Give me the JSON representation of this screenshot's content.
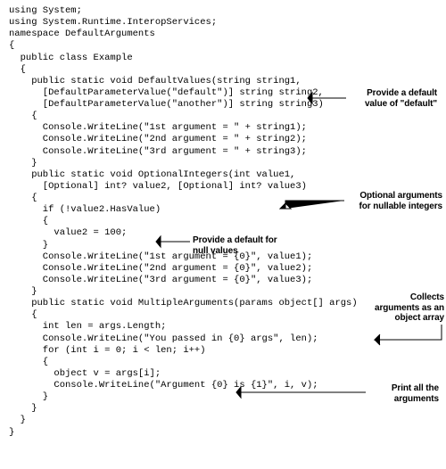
{
  "code": {
    "l1": "using System;",
    "l2": "using System.Runtime.InteropServices;",
    "l3": "",
    "l4": "namespace DefaultArguments",
    "l5": "{",
    "l6": "  public class Example",
    "l7": "  {",
    "l8": "    public static void DefaultValues(string string1,",
    "l9": "      [DefaultParameterValue(\"default\")] string string2,",
    "l10": "      [DefaultParameterValue(\"another\")] string string3)",
    "l11": "    {",
    "l12": "      Console.WriteLine(\"1st argument = \" + string1);",
    "l13": "      Console.WriteLine(\"2nd argument = \" + string2);",
    "l14": "      Console.WriteLine(\"3rd argument = \" + string3);",
    "l15": "    }",
    "l16": "",
    "l17": "    public static void OptionalIntegers(int value1,",
    "l18": "      [Optional] int? value2, [Optional] int? value3)",
    "l19": "    {",
    "l20": "      if (!value2.HasValue)",
    "l21": "      {",
    "l22": "        value2 = 100;",
    "l23": "      }",
    "l24": "      Console.WriteLine(\"1st argument = {0}\", value1);",
    "l25": "      Console.WriteLine(\"2nd argument = {0}\", value2);",
    "l26": "      Console.WriteLine(\"3rd argument = {0}\", value3);",
    "l27": "    }",
    "l28": "",
    "l29": "    public static void MultipleArguments(params object[] args)",
    "l30": "    {",
    "l31": "      int len = args.Length;",
    "l32": "      Console.WriteLine(\"You passed in {0} args\", len);",
    "l33": "      for (int i = 0; i < len; i++)",
    "l34": "      {",
    "l35": "        object v = args[i];",
    "l36": "        Console.WriteLine(\"Argument {0} is {1}\", i, v);",
    "l37": "      }",
    "l38": "    }",
    "l39": "  }",
    "l40": "}"
  },
  "annot": {
    "a1": "Provide a default\nvalue of \"default\"",
    "a2": "Optional arguments\nfor nullable integers",
    "a3": "Provide a default\nfor null values",
    "a4": "Collects\narguments as\nan object array",
    "a5": "Print all the\narguments"
  }
}
